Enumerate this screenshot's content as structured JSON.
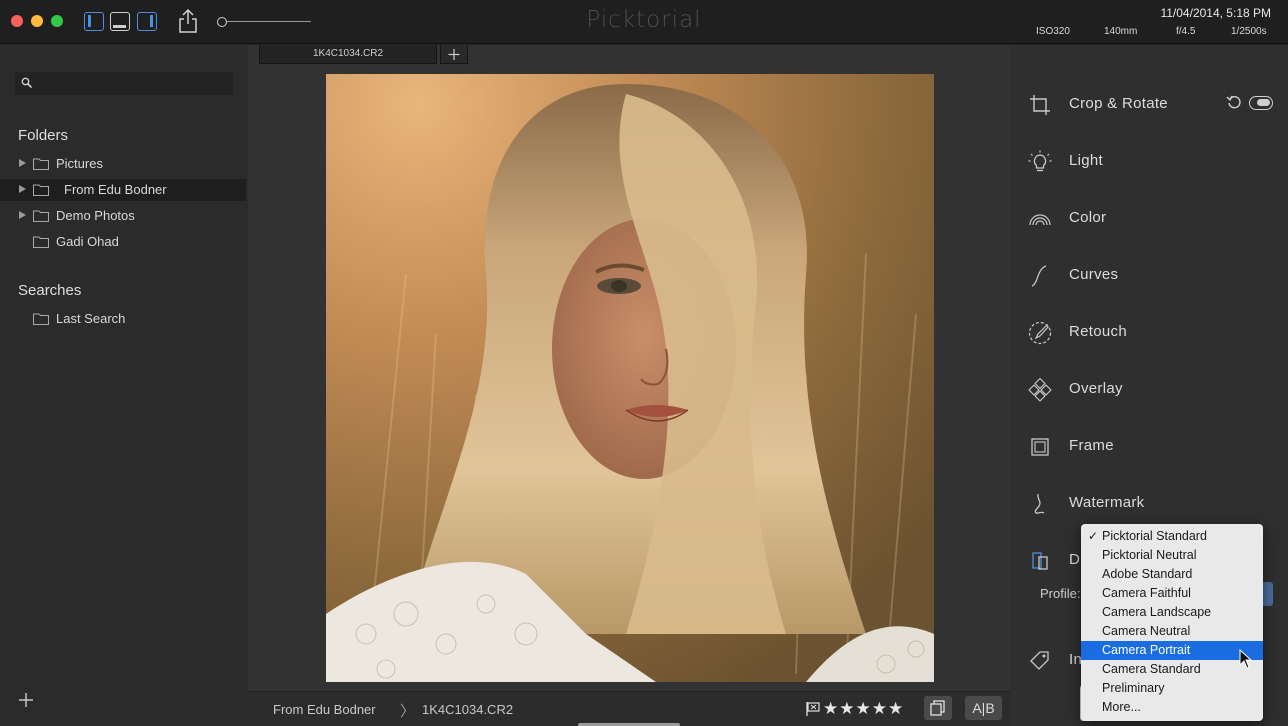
{
  "window": {
    "app_title": "Picktorial",
    "datetime": "11/04/2014, 5:18 PM",
    "exif": {
      "iso": "ISO320",
      "focal": "140mm",
      "aperture": "f/4.5",
      "shutter": "1/2500s"
    }
  },
  "sidebar": {
    "search_placeholder": "",
    "folders_title": "Folders",
    "folders": [
      {
        "label": "Pictures",
        "expandable": true,
        "selected": false
      },
      {
        "label": "From Edu Bodner",
        "expandable": true,
        "selected": true
      },
      {
        "label": "Demo Photos",
        "expandable": true,
        "selected": false
      },
      {
        "label": "Gadi Ohad",
        "expandable": false,
        "selected": false
      }
    ],
    "searches_title": "Searches",
    "searches": [
      {
        "label": "Last Search"
      }
    ],
    "add_icon": "plus-icon"
  },
  "tabs": [
    {
      "label": "1K4C1034.CR2"
    }
  ],
  "bottombar": {
    "crumb_folder": "From Edu Bodner",
    "crumb_separator": "〉",
    "crumb_file": "1K4C1034.CR2",
    "stars": "★★★★★",
    "ab_label": "A|B"
  },
  "tools": [
    {
      "label": "Crop & Rotate",
      "icon": "crop-icon"
    },
    {
      "label": "Light",
      "icon": "lightbulb-icon"
    },
    {
      "label": "Color",
      "icon": "rainbow-icon"
    },
    {
      "label": "Curves",
      "icon": "curve-icon"
    },
    {
      "label": "Retouch",
      "icon": "brush-icon"
    },
    {
      "label": "Overlay",
      "icon": "overlay-icon"
    },
    {
      "label": "Frame",
      "icon": "frame-icon"
    },
    {
      "label": "Watermark",
      "icon": "watermark-icon"
    },
    {
      "label": "D",
      "icon": "details-icon"
    },
    {
      "label": "In",
      "icon": "tag-icon"
    }
  ],
  "profile": {
    "label": "Profile:",
    "options": [
      "Picktorial Standard",
      "Picktorial Neutral",
      "Adobe Standard",
      "Camera Faithful",
      "Camera Landscape",
      "Camera Neutral",
      "Camera Portrait",
      "Camera Standard",
      "Preliminary",
      "More..."
    ],
    "checked": "Picktorial Standard",
    "highlighted": "Camera Portrait"
  },
  "colors": {
    "accent_blue": "#4a8fe0",
    "menu_highlight": "#1a6de0",
    "panel_bg": "#2f2f2f",
    "sidebar_bg": "#2b2b2b"
  }
}
